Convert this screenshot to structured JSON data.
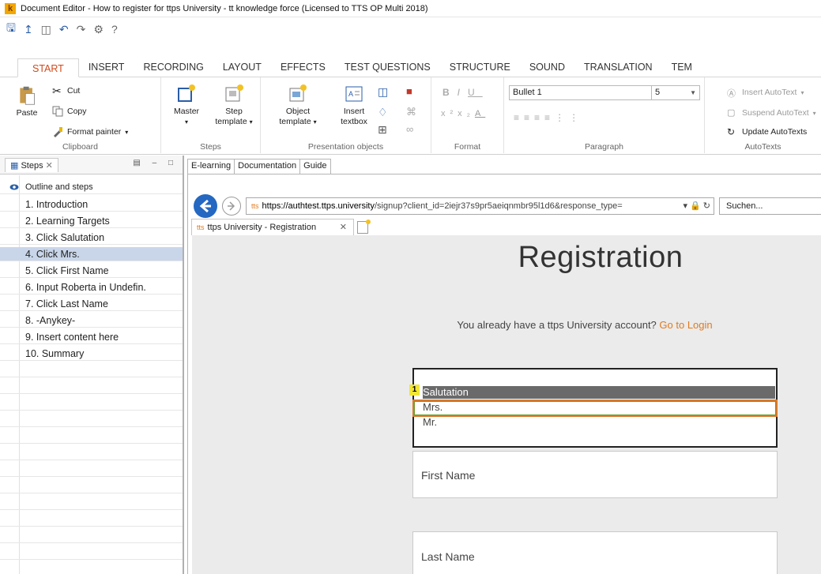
{
  "window": {
    "title": "Document Editor - How to register for ttps University - tt knowledge force (Licensed to TTS OP Multi 2018)"
  },
  "ribbon": {
    "tabs": [
      "START",
      "INSERT",
      "RECORDING",
      "LAYOUT",
      "EFFECTS",
      "TEST QUESTIONS",
      "STRUCTURE",
      "SOUND",
      "TRANSLATION",
      "TEM"
    ],
    "clipboard": {
      "paste": "Paste",
      "cut": "Cut",
      "copy": "Copy",
      "format_painter": "Format painter",
      "label": "Clipboard"
    },
    "steps": {
      "master": "Master",
      "step_template_1": "Step",
      "step_template_2": "template",
      "label": "Steps"
    },
    "presentation": {
      "object_1": "Object",
      "object_2": "template",
      "insert_1": "Insert",
      "insert_2": "textbox",
      "label": "Presentation objects"
    },
    "format": {
      "label": "Format"
    },
    "paragraph": {
      "style": "Bullet 1",
      "size": "5",
      "label": "Paragraph"
    },
    "autotexts": {
      "insert": "Insert AutoText",
      "suspend": "Suspend AutoText",
      "update": "Update AutoTexts",
      "label": "AutoTexts"
    }
  },
  "steps_panel": {
    "tab_label": "Steps",
    "header": "Outline and steps",
    "items": [
      "1. Introduction",
      "2. Learning Targets",
      "3. Click Salutation",
      "4. Click Mrs.",
      "5. Click First Name",
      "6. Input Roberta in Undefin.",
      "7. Click Last Name",
      "8.  -Anykey-",
      "9. Insert content here",
      "10. Summary"
    ],
    "selected_index": 3
  },
  "doc_tabs": [
    "E-learning",
    "Documentation",
    "Guide"
  ],
  "browser": {
    "url_prefix": "tts",
    "url_host": "https://authtest.ttps.university",
    "url_rest": "/signup?client_id=2iejr37s9pr5aeiqnmbr95l1d6&response_type=",
    "search_placeholder": "Suchen...",
    "tab_title": "ttps University - Registration"
  },
  "page": {
    "title": "Registration",
    "subtitle": "You already have a ttps University account?",
    "login_link": "Go to Login",
    "salutation_options": [
      "Salutation",
      "Mrs.",
      "Mr."
    ],
    "badge": "1",
    "first_name": "First Name",
    "last_name": "Last Name"
  },
  "colors": {
    "accent": "#d2491b",
    "link": "#e07a1f",
    "selection": "#c9d6ea",
    "highlight_border": "#d97a2a",
    "browser_back": "#2468c2"
  }
}
